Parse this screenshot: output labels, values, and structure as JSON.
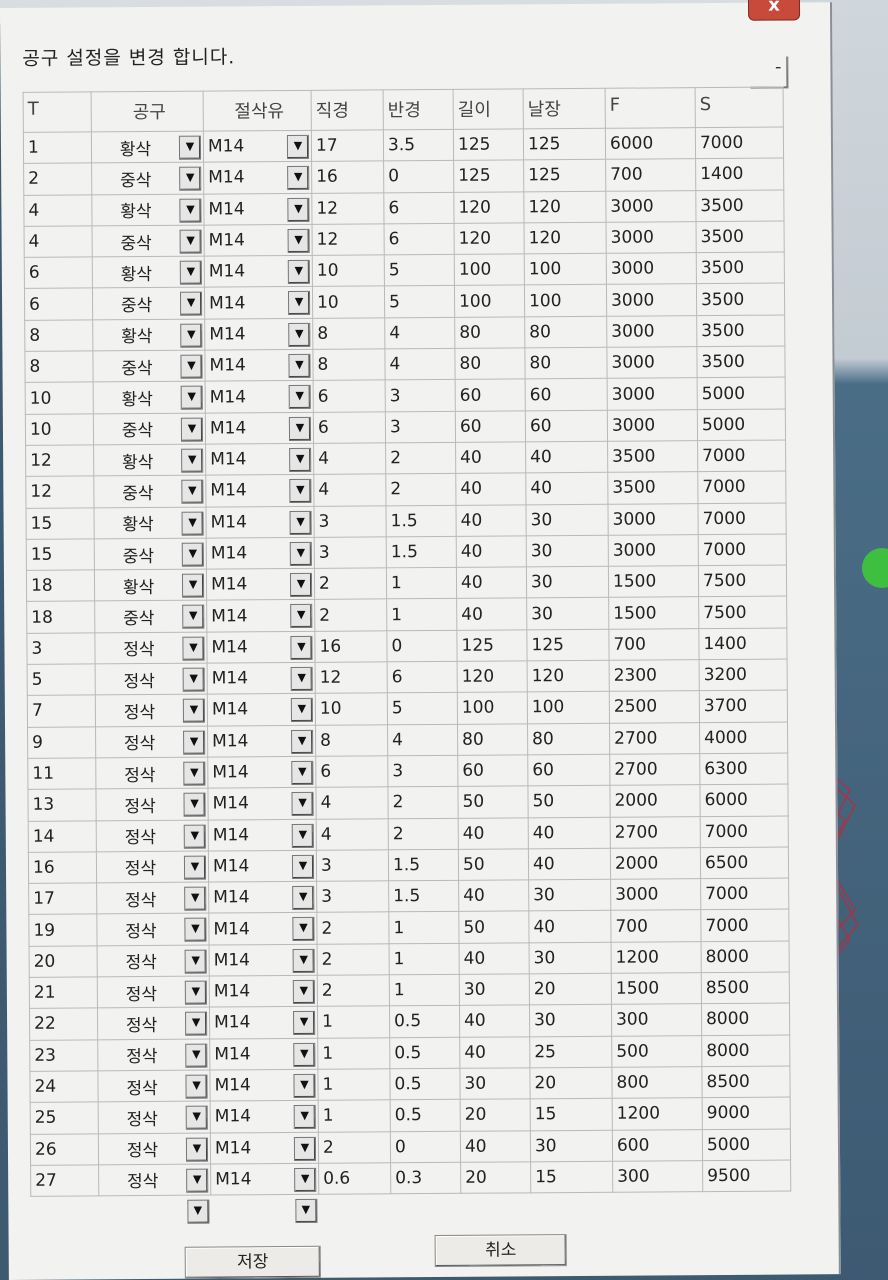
{
  "window": {
    "close_label": "x",
    "title": "공구 설정을 변경 합니다.",
    "minimize_label": "-"
  },
  "table": {
    "columns": [
      "T",
      "공구",
      "절삭유",
      "직경",
      "반경",
      "길이",
      "날장",
      "F",
      "S"
    ],
    "rows": [
      [
        "1",
        "황삭",
        "M14",
        "17",
        "3.5",
        "125",
        "125",
        "6000",
        "7000"
      ],
      [
        "2",
        "중삭",
        "M14",
        "16",
        "0",
        "125",
        "125",
        "700",
        "1400"
      ],
      [
        "4",
        "황삭",
        "M14",
        "12",
        "6",
        "120",
        "120",
        "3000",
        "3500"
      ],
      [
        "4",
        "중삭",
        "M14",
        "12",
        "6",
        "120",
        "120",
        "3000",
        "3500"
      ],
      [
        "6",
        "황삭",
        "M14",
        "10",
        "5",
        "100",
        "100",
        "3000",
        "3500"
      ],
      [
        "6",
        "중삭",
        "M14",
        "10",
        "5",
        "100",
        "100",
        "3000",
        "3500"
      ],
      [
        "8",
        "황삭",
        "M14",
        "8",
        "4",
        "80",
        "80",
        "3000",
        "3500"
      ],
      [
        "8",
        "중삭",
        "M14",
        "8",
        "4",
        "80",
        "80",
        "3000",
        "3500"
      ],
      [
        "10",
        "황삭",
        "M14",
        "6",
        "3",
        "60",
        "60",
        "3000",
        "5000"
      ],
      [
        "10",
        "중삭",
        "M14",
        "6",
        "3",
        "60",
        "60",
        "3000",
        "5000"
      ],
      [
        "12",
        "황삭",
        "M14",
        "4",
        "2",
        "40",
        "40",
        "3500",
        "7000"
      ],
      [
        "12",
        "중삭",
        "M14",
        "4",
        "2",
        "40",
        "40",
        "3500",
        "7000"
      ],
      [
        "15",
        "황삭",
        "M14",
        "3",
        "1.5",
        "40",
        "30",
        "3000",
        "7000"
      ],
      [
        "15",
        "중삭",
        "M14",
        "3",
        "1.5",
        "40",
        "30",
        "3000",
        "7000"
      ],
      [
        "18",
        "황삭",
        "M14",
        "2",
        "1",
        "40",
        "30",
        "1500",
        "7500"
      ],
      [
        "18",
        "중삭",
        "M14",
        "2",
        "1",
        "40",
        "30",
        "1500",
        "7500"
      ],
      [
        "3",
        "정삭",
        "M14",
        "16",
        "0",
        "125",
        "125",
        "700",
        "1400"
      ],
      [
        "5",
        "정삭",
        "M14",
        "12",
        "6",
        "120",
        "120",
        "2300",
        "3200"
      ],
      [
        "7",
        "정삭",
        "M14",
        "10",
        "5",
        "100",
        "100",
        "2500",
        "3700"
      ],
      [
        "9",
        "정삭",
        "M14",
        "8",
        "4",
        "80",
        "80",
        "2700",
        "4000"
      ],
      [
        "11",
        "정삭",
        "M14",
        "6",
        "3",
        "60",
        "60",
        "2700",
        "6300"
      ],
      [
        "13",
        "정삭",
        "M14",
        "4",
        "2",
        "50",
        "50",
        "2000",
        "6000"
      ],
      [
        "14",
        "정삭",
        "M14",
        "4",
        "2",
        "40",
        "40",
        "2700",
        "7000"
      ],
      [
        "16",
        "정삭",
        "M14",
        "3",
        "1.5",
        "50",
        "40",
        "2000",
        "6500"
      ],
      [
        "17",
        "정삭",
        "M14",
        "3",
        "1.5",
        "40",
        "30",
        "3000",
        "7000"
      ],
      [
        "19",
        "정삭",
        "M14",
        "2",
        "1",
        "50",
        "40",
        "700",
        "7000"
      ],
      [
        "20",
        "정삭",
        "M14",
        "2",
        "1",
        "40",
        "30",
        "1200",
        "8000"
      ],
      [
        "21",
        "정삭",
        "M14",
        "2",
        "1",
        "30",
        "20",
        "1500",
        "8500"
      ],
      [
        "22",
        "정삭",
        "M14",
        "1",
        "0.5",
        "40",
        "30",
        "300",
        "8000"
      ],
      [
        "23",
        "정삭",
        "M14",
        "1",
        "0.5",
        "40",
        "25",
        "500",
        "8000"
      ],
      [
        "24",
        "정삭",
        "M14",
        "1",
        "0.5",
        "30",
        "20",
        "800",
        "8500"
      ],
      [
        "25",
        "정삭",
        "M14",
        "1",
        "0.5",
        "20",
        "15",
        "1200",
        "9000"
      ],
      [
        "26",
        "정삭",
        "M14",
        "2",
        "0",
        "40",
        "30",
        "600",
        "5000"
      ],
      [
        "27",
        "정삭",
        "M14",
        "0.6",
        "0.3",
        "20",
        "15",
        "300",
        "9500"
      ]
    ]
  },
  "buttons": {
    "save_label": "저장",
    "cancel_label": "취소"
  },
  "icons": {
    "dropdown": "chevron-down-icon"
  }
}
